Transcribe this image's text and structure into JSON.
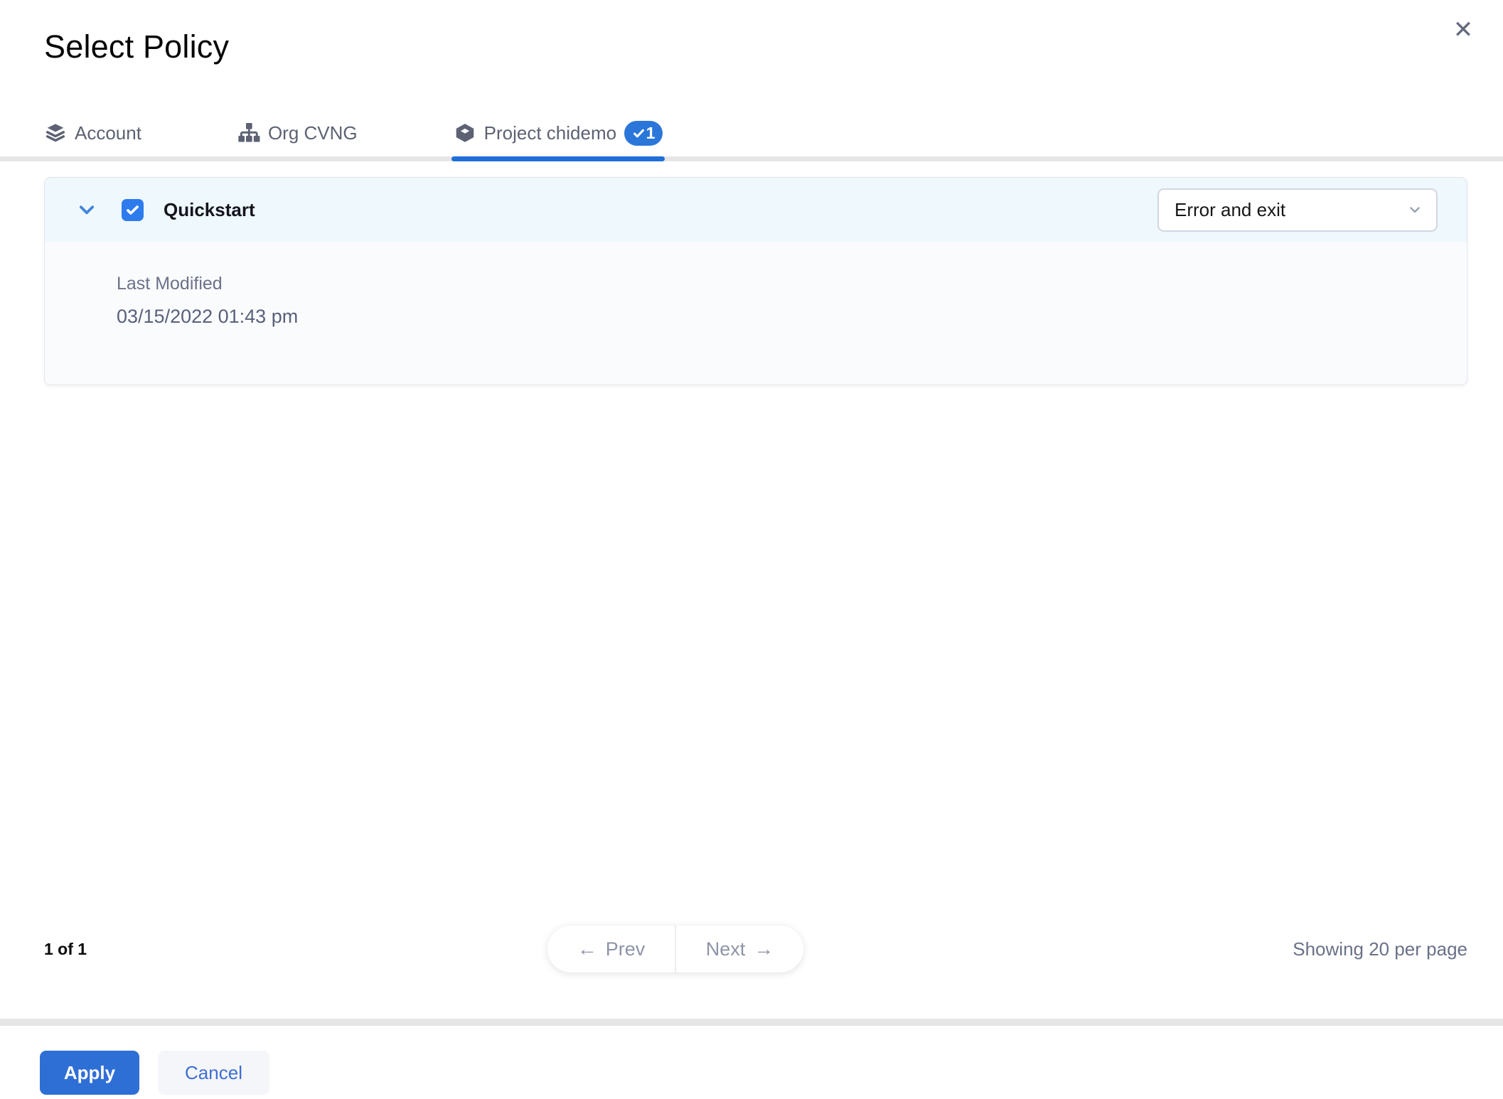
{
  "modal": {
    "title": "Select Policy",
    "close_glyph": "✕"
  },
  "tabs": [
    {
      "label": "Account",
      "icon": "layers-icon",
      "active": false
    },
    {
      "label": "Org CVNG",
      "icon": "org-chart-icon",
      "active": false
    },
    {
      "label": "Project chidemo",
      "icon": "cube-icon",
      "active": true,
      "badge_count": "1",
      "badge_check": "checkmark-icon"
    }
  ],
  "policy": {
    "name": "Quickstart",
    "checked": true,
    "action_value": "Error and exit",
    "last_modified_label": "Last Modified",
    "last_modified_value": "03/15/2022 01:43 pm"
  },
  "pagination": {
    "page_info": "1 of 1",
    "prev_arrow": "←",
    "prev_label": "Prev",
    "next_label": "Next",
    "next_arrow": "→",
    "showing": "Showing 20 per page"
  },
  "footer": {
    "apply_label": "Apply",
    "cancel_label": "Cancel"
  },
  "colors": {
    "accent_blue": "#2e6fd6",
    "checkbox_blue": "#2e7bee",
    "tab_underline_blue": "#1f6ed9",
    "badge_blue": "#2b77d9",
    "card_header_bg": "#eef8fd",
    "card_body_bg": "#fafbfd",
    "divider_gray": "#e6e6e8",
    "muted_text": "#6b7287",
    "pager_text": "#8e94a7"
  }
}
